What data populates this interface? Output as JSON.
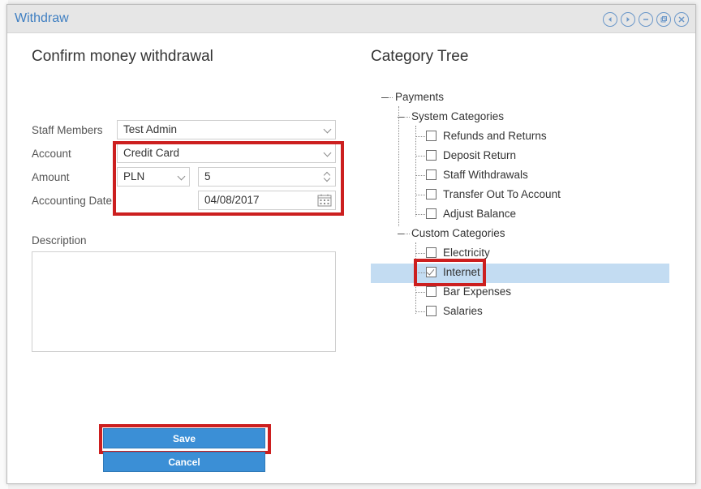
{
  "window": {
    "title": "Withdraw",
    "controls": [
      "prev-icon",
      "next-icon",
      "minimize-icon",
      "restore-icon",
      "close-icon"
    ]
  },
  "form": {
    "heading": "Confirm money withdrawal",
    "staff_label": "Staff Members",
    "staff_value": "Test Admin",
    "account_label": "Account",
    "account_value": "Credit Card",
    "amount_label": "Amount",
    "currency_value": "PLN",
    "amount_value": "5",
    "date_label": "Accounting Date",
    "date_value": "04/08/2017",
    "description_label": "Description",
    "description_value": ""
  },
  "buttons": {
    "save": "Save",
    "cancel": "Cancel"
  },
  "tree": {
    "heading": "Category Tree",
    "root": "Payments",
    "system": {
      "label": "System Categories",
      "items": [
        {
          "label": "Refunds and Returns",
          "checked": false
        },
        {
          "label": "Deposit Return",
          "checked": false
        },
        {
          "label": "Staff Withdrawals",
          "checked": false
        },
        {
          "label": "Transfer Out To Account",
          "checked": false
        },
        {
          "label": "Adjust Balance",
          "checked": false
        }
      ]
    },
    "custom": {
      "label": "Custom Categories",
      "items": [
        {
          "label": "Electricity",
          "checked": false
        },
        {
          "label": "Internet",
          "checked": true
        },
        {
          "label": "Bar Expenses",
          "checked": false
        },
        {
          "label": "Salaries",
          "checked": false
        }
      ]
    }
  },
  "colors": {
    "accent": "#3b8fd6",
    "highlight": "#cc1f1f",
    "selected_row": "#c3dcf2",
    "title_text": "#3f7fc2"
  }
}
